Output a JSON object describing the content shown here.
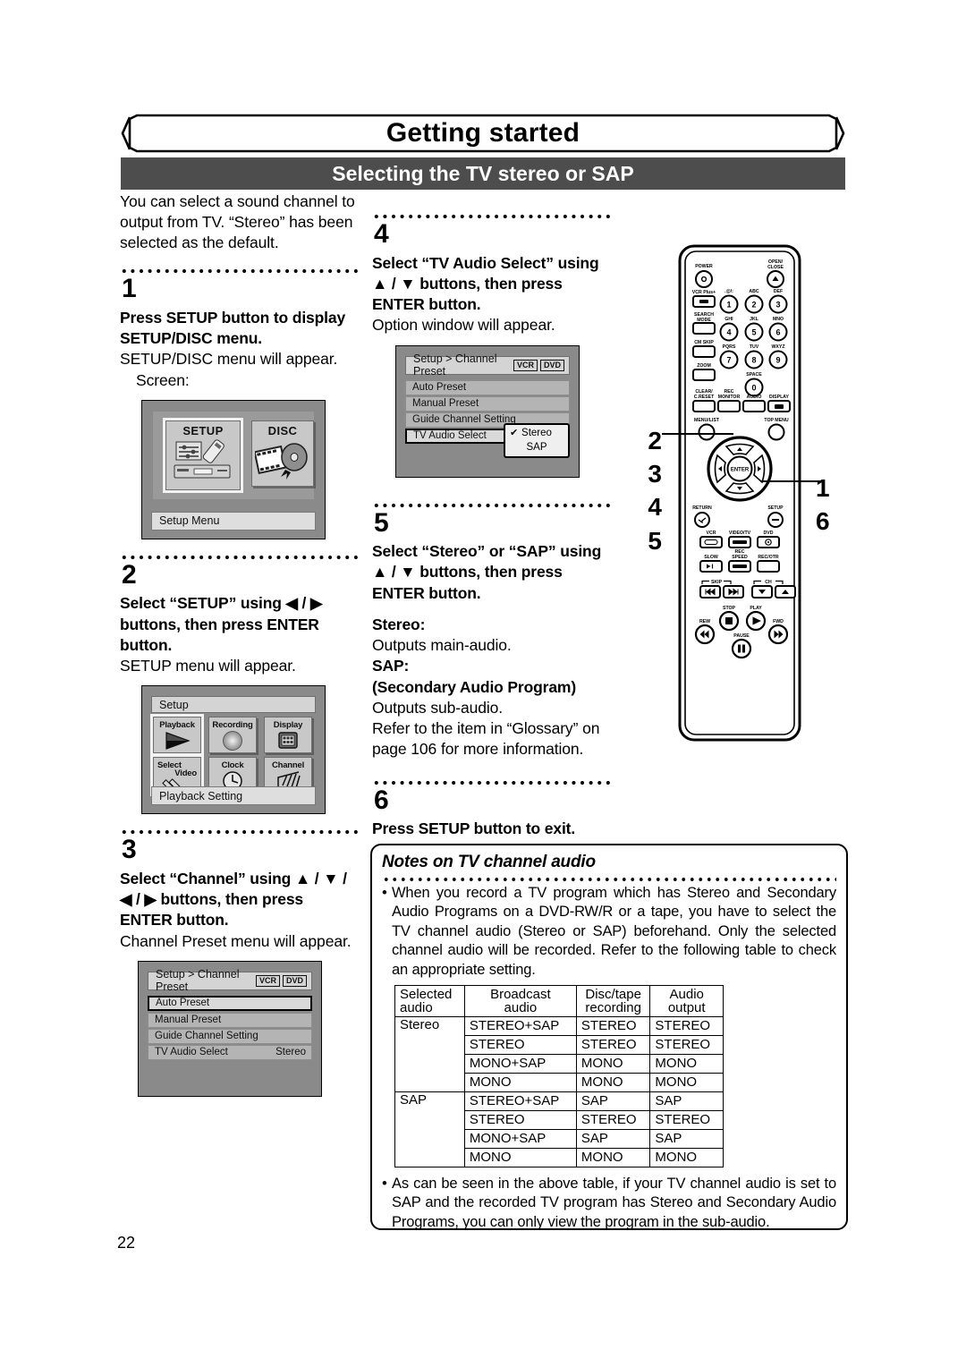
{
  "header": {
    "banner_title": "Getting started",
    "section_title": "Selecting the TV stereo or SAP"
  },
  "intro": "You can select a sound channel to output from TV. “Stereo” has been selected as the default.",
  "steps": [
    {
      "number": "1",
      "bold": "Press SETUP button to display SETUP/DISC menu.",
      "text": "SETUP/DISC menu will appear.",
      "subtext": "Screen:"
    },
    {
      "number": "2",
      "bold": "Select “SETUP” using ◀ / ▶ buttons, then press ENTER button.",
      "text": "SETUP menu will appear."
    },
    {
      "number": "3",
      "bold": "Select “Channel” using ▲ / ▼ / ◀ / ▶ buttons, then press ENTER button.",
      "text": "Channel Preset menu will appear."
    },
    {
      "number": "4",
      "bold": "Select “TV Audio Select” using ▲ / ▼ buttons, then press ENTER button.",
      "text": "Option window will appear."
    },
    {
      "number": "5",
      "bold": "Select “Stereo” or “SAP” using ▲ / ▼ buttons, then press ENTER button.",
      "stereo_label": "Stereo:",
      "stereo_text": "Outputs main-audio.",
      "sap_label": "SAP:",
      "sap_sub": "(Secondary Audio Program)",
      "sap_text": "Outputs sub-audio.",
      "refer": "Refer to the item in “Glossary” on page 106 for more information."
    },
    {
      "number": "6",
      "bold": "Press SETUP button to exit."
    }
  ],
  "osd_setup_disc": {
    "tiles": [
      "SETUP",
      "DISC"
    ],
    "caption": "Setup Menu"
  },
  "osd_setup_menu": {
    "header": "Setup",
    "tiles": [
      "Playback",
      "Recording",
      "Display",
      "Select Video",
      "Clock",
      "Channel"
    ],
    "tile_select_video_line1": "Select",
    "tile_select_video_line2": "Video",
    "caption": "Playback Setting"
  },
  "osd_channel_preset": {
    "header": "Setup > Channel Preset",
    "tags": [
      "VCR",
      "DVD"
    ],
    "rows": [
      {
        "label": "Auto Preset",
        "value": ""
      },
      {
        "label": "Manual Preset",
        "value": ""
      },
      {
        "label": "Guide Channel Setting",
        "value": ""
      },
      {
        "label": "TV Audio Select",
        "value": "Stereo"
      }
    ]
  },
  "osd_channel_preset_popup": {
    "header": "Setup > Channel Preset",
    "tags": [
      "VCR",
      "DVD"
    ],
    "rows": [
      {
        "label": "Auto Preset",
        "value": ""
      },
      {
        "label": "Manual Preset",
        "value": ""
      },
      {
        "label": "Guide Channel Setting",
        "value": ""
      },
      {
        "label": "TV Audio Select",
        "value": ""
      }
    ],
    "options": [
      "Stereo",
      "SAP"
    ],
    "checked": "Stereo",
    "check_glyph": "✔"
  },
  "notes": {
    "title": "Notes on TV channel audio",
    "bullet1": "When you record a TV program which has Stereo and Secondary Audio Programs on a DVD-RW/R or a tape, you have to select the TV channel audio (Stereo or SAP) beforehand. Only the selected channel audio will be recorded. Refer to the following table to check an appropriate setting.",
    "bullet2": "As can be seen in the above table, if your TV channel audio is set to SAP and the recorded TV program has Stereo and Secondary Audio Programs, you can only view the program in the sub-audio."
  },
  "audio_table": {
    "headers": [
      [
        "Selected",
        "audio"
      ],
      [
        "Broadcast",
        "audio"
      ],
      [
        "Disc/tape",
        "recording"
      ],
      [
        "Audio",
        "output"
      ]
    ],
    "groups": [
      {
        "selected": "Stereo",
        "rows": [
          [
            "STEREO+SAP",
            "STEREO",
            "STEREO"
          ],
          [
            "STEREO",
            "STEREO",
            "STEREO"
          ],
          [
            "MONO+SAP",
            "MONO",
            "MONO"
          ],
          [
            "MONO",
            "MONO",
            "MONO"
          ]
        ]
      },
      {
        "selected": "SAP",
        "rows": [
          [
            "STEREO+SAP",
            "SAP",
            "SAP"
          ],
          [
            "STEREO",
            "STEREO",
            "STEREO"
          ],
          [
            "MONO+SAP",
            "SAP",
            "SAP"
          ],
          [
            "MONO",
            "MONO",
            "MONO"
          ]
        ]
      }
    ]
  },
  "remote": {
    "labels": {
      "power": "POWER",
      "open_close_1": "OPEN/",
      "open_close_2": "CLOSE",
      "vcr_plus": "VCR Plus+",
      "search_mode_1": "SEARCH",
      "search_mode_2": "MODE",
      "cm_skip": "CM SKIP",
      "zoom": "ZOOM",
      "clear_1": "CLEAR/",
      "clear_2": "C.RESET",
      "rec_monitor_1": "REC",
      "rec_monitor_2": "MONITOR",
      "audio": "AUDIO",
      "display": "DISPLAY",
      "menu_list": "MENU/LIST",
      "top_menu": "TOP MENU",
      "enter": "ENTER",
      "return": "RETURN",
      "setup": "SETUP",
      "vcr": "VCR",
      "video_tv": "VIDEO/TV",
      "dvd": "DVD",
      "slow": "SLOW",
      "rec_speed_1": "REC",
      "rec_speed_2": "SPEED",
      "rec_otr": "REC/OTR",
      "skip": "SKIP",
      "ch": "CH",
      "stop": "STOP",
      "play": "PLAY",
      "rew": "REW",
      "fwd": "FWD",
      "pause": "PAUSE"
    },
    "keypad": [
      {
        "num": "1",
        "letters": ".@/:"
      },
      {
        "num": "2",
        "letters": "ABC"
      },
      {
        "num": "3",
        "letters": "DEF"
      },
      {
        "num": "4",
        "letters": "GHI"
      },
      {
        "num": "5",
        "letters": "JKL"
      },
      {
        "num": "6",
        "letters": "MNO"
      },
      {
        "num": "7",
        "letters": "PQRS"
      },
      {
        "num": "8",
        "letters": "TUV"
      },
      {
        "num": "9",
        "letters": "WXYZ"
      },
      {
        "num": "0",
        "letters": "SPACE"
      }
    ],
    "callouts_left": [
      "2",
      "3",
      "4",
      "5"
    ],
    "callouts_right": [
      "1",
      "6"
    ]
  },
  "page_number": "22"
}
